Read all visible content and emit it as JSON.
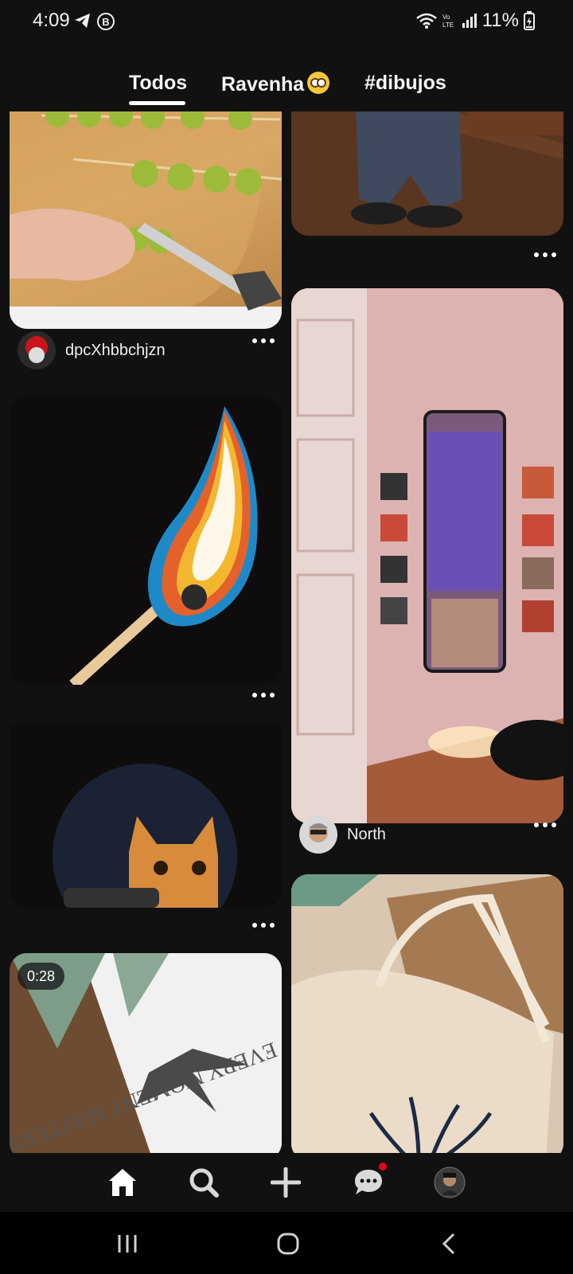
{
  "status_bar": {
    "time": "4:09",
    "battery": "11%"
  },
  "tabs": [
    {
      "label": "Todos"
    },
    {
      "label": "Ravenha"
    },
    {
      "label": "#dibujos"
    }
  ],
  "pins": {
    "grapes": {
      "author": "dpcXhbbchjzn"
    },
    "room": {
      "author": "North"
    },
    "plane": {
      "duration": "0:28",
      "text": "EVERY MOMENT MATTERS"
    }
  },
  "colors": {
    "background": "#111111",
    "notification": "#e60023"
  },
  "icons": [
    "home-icon",
    "search-icon",
    "plus-icon",
    "chat-icon",
    "profile-avatar",
    "recents-icon",
    "home-circle-icon",
    "back-icon"
  ]
}
